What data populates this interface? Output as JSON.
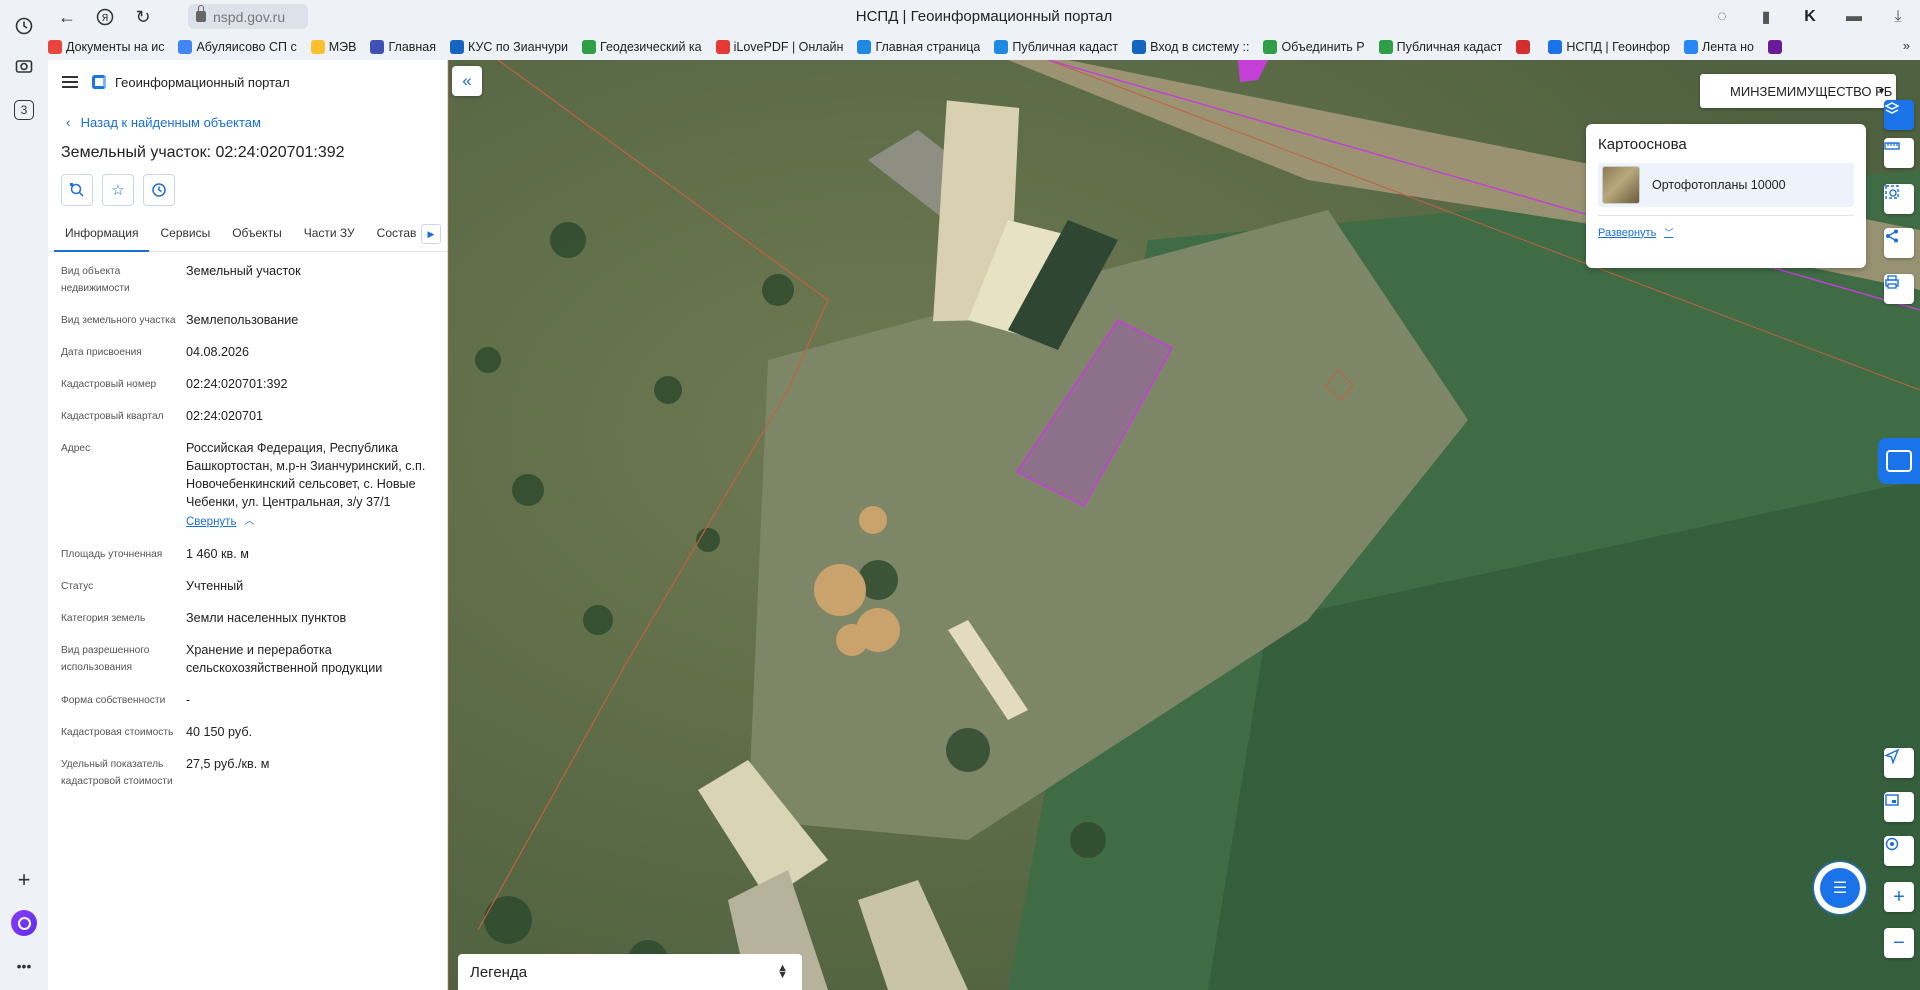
{
  "browser": {
    "url": "nspd.gov.ru",
    "window_title": "НСПД | Геоинформационный портал",
    "rail_tab_count": "3",
    "bookmarks": [
      {
        "label": "Документы на ис",
        "color": "#e8453c"
      },
      {
        "label": "Абуляисово СП с",
        "color": "#4285f4"
      },
      {
        "label": "МЭВ",
        "color": "#fbc02d"
      },
      {
        "label": "Главная",
        "color": "#3f51b5"
      },
      {
        "label": "КУС по Зианчури",
        "color": "#1565c0"
      },
      {
        "label": "Геодезический ка",
        "color": "#2e9e47"
      },
      {
        "label": "iLovePDF | Онлайн",
        "color": "#e53935"
      },
      {
        "label": "Главная страница",
        "color": "#1e88e5"
      },
      {
        "label": "Публичная кадаст",
        "color": "#1e88e5"
      },
      {
        "label": "Вход в систему :: ",
        "color": "#1565c0"
      },
      {
        "label": "Объединить P",
        "color": "#2e9e47"
      },
      {
        "label": "Публичная кадаст",
        "color": "#2e9e47"
      },
      {
        "label": "",
        "color": "#d32f2f"
      },
      {
        "label": "НСПД | Геоинфор",
        "color": "#1a73e8"
      },
      {
        "label": "Лента но",
        "color": "#2787f5"
      },
      {
        "label": "",
        "color": "#6a1b9a"
      }
    ]
  },
  "panel": {
    "portal_name": "Геоинформационный портал",
    "back_label": "Назад к найденным объектам",
    "title": "Земельный участок: 02:24:020701:392",
    "tabs": [
      "Информация",
      "Сервисы",
      "Объекты",
      "Части ЗУ",
      "Состав"
    ],
    "properties": [
      {
        "label": "Вид объекта недвижимости",
        "value": "Земельный участок"
      },
      {
        "label": "Вид земельного участка",
        "value": "Землепользование"
      },
      {
        "label": "Дата присвоения",
        "value": "04.08.2026"
      },
      {
        "label": "Кадастровый номер",
        "value": "02:24:020701:392"
      },
      {
        "label": "Кадастровый квартал",
        "value": "02:24:020701"
      },
      {
        "label": "Адрес",
        "value": "Российская Федерация, Республика Башкортостан, м.р-н Зианчуринский, с.п. Новочебенкинский сельсовет, с. Новые Чебенки, ул. Центральная, з/у 37/1"
      },
      {
        "label": "Площадь уточненная",
        "value": "1 460 кв. м"
      },
      {
        "label": "Статус",
        "value": "Учтенный"
      },
      {
        "label": "Категория земель",
        "value": "Земли населенных пунктов"
      },
      {
        "label": "Вид разрешенного использования",
        "value": "Хранение и переработка сельскохозяйственной продукции"
      },
      {
        "label": "Форма собственности",
        "value": "-"
      },
      {
        "label": "Кадастровая стоимость",
        "value": "40 150 руб."
      },
      {
        "label": "Удельный показатель кадастровой стоимости",
        "value": "27,5 руб./кв. м"
      }
    ],
    "collapse_label": "Свернуть"
  },
  "map": {
    "org_select": "МИНЗЕМИМУЩЕСТВО РБ",
    "basemap_title": "Картооснова",
    "basemap_name": "Ортофотопланы 10000",
    "expand_label": "Развернуть",
    "legend_label": "Легенда",
    "colors": {
      "parcel_fill": "#9a5fa8",
      "parcel_border": "#c43fd6",
      "boundary": "#c0623f",
      "accent": "#1a73e8"
    }
  }
}
